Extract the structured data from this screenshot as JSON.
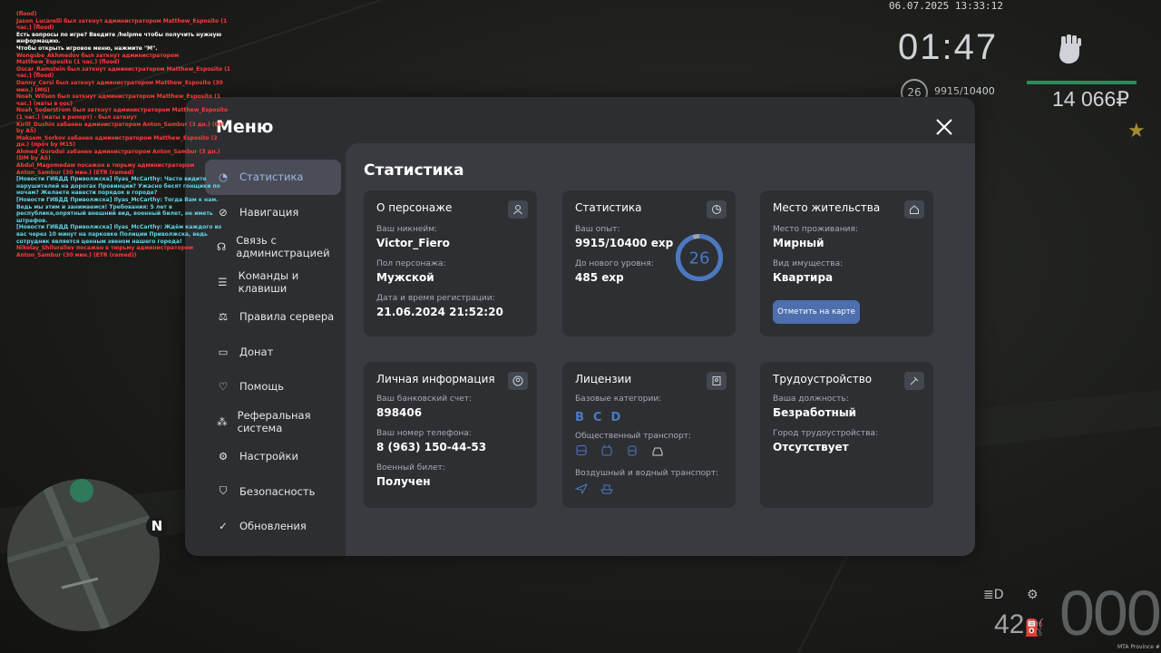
{
  "chat": [
    {
      "text": "(flood)",
      "color": "#ff3b3b"
    },
    {
      "text": "Jason_Lucarelli был заткнут администратором Matthew_Esposito (1 час.) (flood)",
      "color": "#ff3b3b"
    },
    {
      "text": "Есть вопросы по игре? Введите /helpme чтобы получить нужную информацию.",
      "color": "#ffffff"
    },
    {
      "text": "Чтобы открыть игровое меню, нажмите \"M\".",
      "color": "#ffffff"
    },
    {
      "text": "Wongsbe_Akhmedov был заткнут администратором Matthew_Esposito (1 час.) (flood)",
      "color": "#ff3b3b"
    },
    {
      "text": "Oscar_Ramstein был заткнут администратором Matthew_Esposito (1 час.) (flood)",
      "color": "#ff3b3b"
    },
    {
      "text": "Danny_Cersi был заткнут администратором Matthew_Esposito (30 мин.) (MG)",
      "color": "#ff3b3b"
    },
    {
      "text": "Noah_Wilson был заткнут администратором Matthew_Esposito (1 час.) (маты в ooc)",
      "color": "#ff3b3b"
    },
    {
      "text": "Noah_Soderstrom был заткнут администратором Matthew_Esposito (1 час.) (маты в репорт) - был заткнут",
      "color": "#ff3b3b"
    },
    {
      "text": "Kirill_Dushin забанен администратором Anton_Sambur (3 дн.) (DM by AS)",
      "color": "#ff3b3b"
    },
    {
      "text": "Maksem_Sorkov забанен администратором Matthew_Esposito (2 дн.) (проч by M15)",
      "color": "#ff3b3b"
    },
    {
      "text": "Ahmed_Gorodol забанен администратором Anton_Sambur (3 дн.) (DM by AS)",
      "color": "#ff3b3b"
    },
    {
      "text": "Abdul_Magomedaw посажен в тюрьму администратором Anton_Sambur (30 мин.) (ETR (ramed)",
      "color": "#ff3b3b"
    },
    {
      "text": "[Новости ГИБДД Приволжска] Ilyas_McCarthy: Часто видите нарушителей на дорогах Провинции? Ужасно бесят гонщики по ночам? Желаете навести порядок в городе?",
      "color": "#5fd6e6"
    },
    {
      "text": "[Новости ГИБДД Приволжска] Ilyas_McCarthy: Тогда Вам к нам. Ведь мы этим и занимаемся! Требования: 5 лет в республике,опрятный внешний вид, военный билет, не иметь штрафов.",
      "color": "#5fd6e6"
    },
    {
      "text": "[Новости ГИБДД Приволжска] Ilyas_McCarthy: Ждём каждого из вас через 10 минут на парковке Полиции Приволжска, ведь сотрудник является ценным звеном нашего города!",
      "color": "#5fd6e6"
    },
    {
      "text": "Nikolay_Shiluraliev посажен в тюрьму администратором Anton_Sambur (30 мин.) (ETR (ramed))",
      "color": "#ff3b3b"
    }
  ],
  "hud": {
    "date": "06.07.2025 13:33:12",
    "time": "01:47",
    "level": "26",
    "exp": "9915/10400",
    "money": "14 066₽",
    "speed": "000",
    "fuel": "42",
    "server": "MTA Province #",
    "compass": "N"
  },
  "menu": {
    "title": "Меню",
    "content_title": "Статистика",
    "nav": [
      {
        "label": "Статистика",
        "icon": "chart-icon",
        "active": true
      },
      {
        "label": "Навигация",
        "icon": "compass-icon"
      },
      {
        "label": "Связь с администрацией",
        "icon": "headset-icon"
      },
      {
        "label": "Команды и клавиши",
        "icon": "document-icon"
      },
      {
        "label": "Правила сервера",
        "icon": "scales-icon"
      },
      {
        "label": "Донат",
        "icon": "wallet-icon"
      },
      {
        "label": "Помощь",
        "icon": "heart-hand-icon"
      },
      {
        "label": "Реферальная система",
        "icon": "network-icon"
      },
      {
        "label": "Настройки",
        "icon": "gear-icon"
      },
      {
        "label": "Безопасность",
        "icon": "shield-icon"
      },
      {
        "label": "Обновления",
        "icon": "check-circle-icon"
      }
    ],
    "cards": {
      "character": {
        "title": "О персонаже",
        "nick_label": "Ваш никнейм:",
        "nick": "Victor_Fiero",
        "gender_label": "Пол персонажа:",
        "gender": "Мужской",
        "reg_label": "Дата и время регистрации:",
        "reg": "21.06.2024 21:52:20"
      },
      "stats": {
        "title": "Статистика",
        "exp_label": "Ваш опыт:",
        "exp": "9915/10400 exp",
        "next_label": "До нового уровня:",
        "next": "485 exp",
        "level": "26",
        "progress": 0.953
      },
      "home": {
        "title": "Место жительства",
        "place_label": "Место проживания:",
        "place": "Мирный",
        "prop_label": "Вид имущества:",
        "prop": "Квартира",
        "button": "Отметить на карте"
      },
      "personal": {
        "title": "Личная информация",
        "bank_label": "Ваш банковский счет:",
        "bank": "898406",
        "phone_label": "Ваш номер телефона:",
        "phone": "8 (963) 150-44-53",
        "military_label": "Военный билет:",
        "military": "Получен"
      },
      "licenses": {
        "title": "Лицензии",
        "base_label": "Базовые категории:",
        "base": [
          "B",
          "C",
          "D"
        ],
        "public_label": "Общественный транспорт:",
        "air_label": "Воздушный и водный транспорт:"
      },
      "job": {
        "title": "Трудоустройство",
        "position_label": "Ваша должность:",
        "position": "Безработный",
        "city_label": "Город трудоустройства:",
        "city": "Отсутствует"
      }
    }
  }
}
